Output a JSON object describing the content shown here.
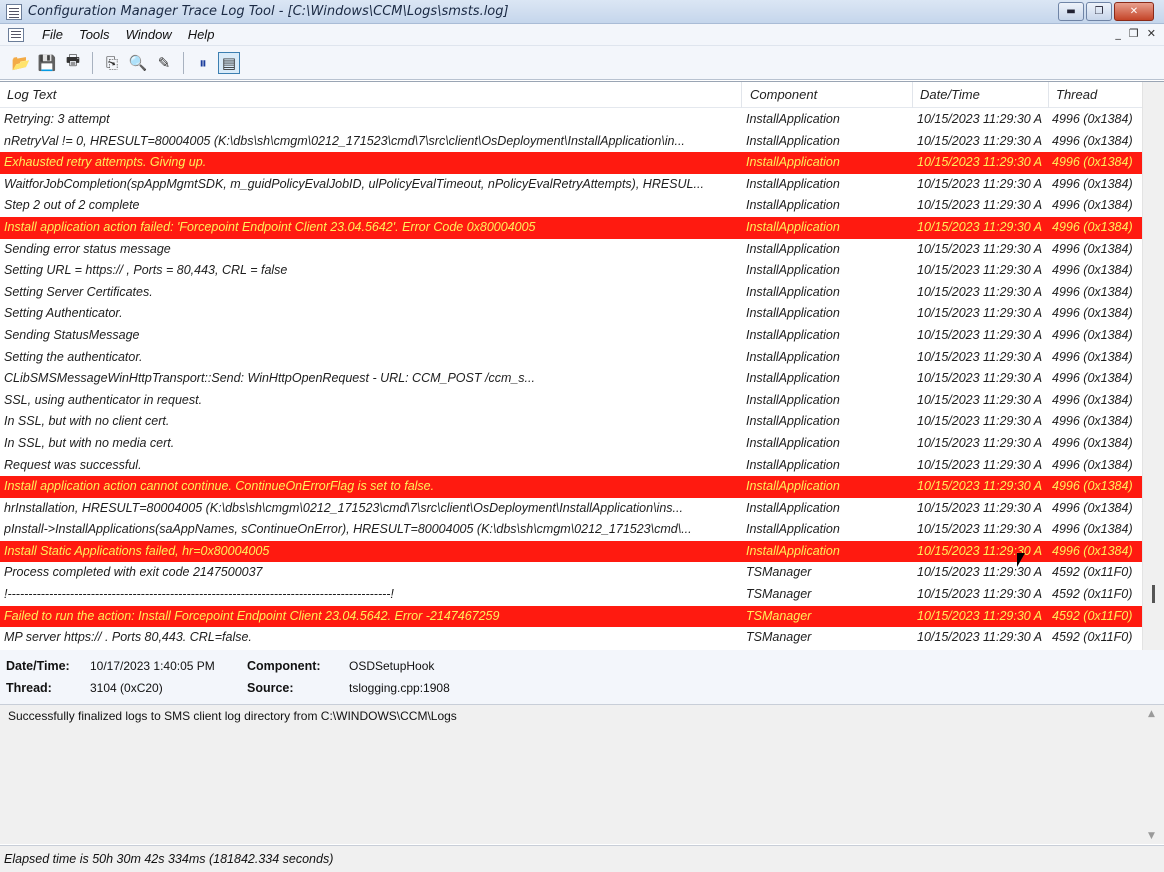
{
  "window": {
    "title": "Configuration Manager Trace Log Tool - [C:\\Windows\\CCM\\Logs\\smsts.log]",
    "min_glyph": "▬",
    "max_glyph": "❐",
    "close_glyph": "✕"
  },
  "menu": {
    "items": [
      "File",
      "Tools",
      "Window",
      "Help"
    ],
    "mdi_min": "_",
    "mdi_restore": "❐",
    "mdi_close": "✕"
  },
  "toolbar": {
    "icons": [
      "open-folder-icon",
      "save-icon",
      "print-icon",
      "copy-icon",
      "find-icon",
      "highlight-icon",
      "pause-icon",
      "details-view-icon"
    ],
    "glyphs": [
      "📂",
      "💾",
      "🖶",
      "⎘",
      "🔍",
      "✎",
      "⏸",
      "▤"
    ]
  },
  "list": {
    "columns": [
      "Log Text",
      "Component",
      "Date/Time",
      "Thread"
    ],
    "rows": [
      {
        "text": "Retrying: 3 attempt",
        "component": "InstallApplication",
        "datetime": "10/15/2023 11:29:30 A",
        "thread": "4996 (0x1384)",
        "error": false
      },
      {
        "text": "nRetryVal != 0, HRESULT=80004005 (K:\\dbs\\sh\\cmgm\\0212_171523\\cmd\\7\\src\\client\\OsDeployment\\InstallApplication\\in...",
        "component": "InstallApplication",
        "datetime": "10/15/2023 11:29:30 A",
        "thread": "4996 (0x1384)",
        "error": false
      },
      {
        "text": "Exhausted retry attempts. Giving up.",
        "component": "InstallApplication",
        "datetime": "10/15/2023 11:29:30 A",
        "thread": "4996 (0x1384)",
        "error": true
      },
      {
        "text": "WaitforJobCompletion(spAppMgmtSDK, m_guidPolicyEvalJobID, ulPolicyEvalTimeout, nPolicyEvalRetryAttempts), HRESUL...",
        "component": "InstallApplication",
        "datetime": "10/15/2023 11:29:30 A",
        "thread": "4996 (0x1384)",
        "error": false
      },
      {
        "text": "Step 2 out of 2 complete",
        "component": "InstallApplication",
        "datetime": "10/15/2023 11:29:30 A",
        "thread": "4996 (0x1384)",
        "error": false
      },
      {
        "text": "Install application action failed: 'Forcepoint Endpoint Client 23.04.5642'. Error Code 0x80004005",
        "component": "InstallApplication",
        "datetime": "10/15/2023 11:29:30 A",
        "thread": "4996 (0x1384)",
        "error": true
      },
      {
        "text": "Sending error status message",
        "component": "InstallApplication",
        "datetime": "10/15/2023 11:29:30 A",
        "thread": "4996 (0x1384)",
        "error": false
      },
      {
        "text": "  Setting URL = https://                                        , Ports = 80,443, CRL = false",
        "component": "InstallApplication",
        "datetime": "10/15/2023 11:29:30 A",
        "thread": "4996 (0x1384)",
        "error": false
      },
      {
        "text": "  Setting Server Certificates.",
        "component": "InstallApplication",
        "datetime": "10/15/2023 11:29:30 A",
        "thread": "4996 (0x1384)",
        "error": false
      },
      {
        "text": "  Setting Authenticator.",
        "component": "InstallApplication",
        "datetime": "10/15/2023 11:29:30 A",
        "thread": "4996 (0x1384)",
        "error": false
      },
      {
        "text": "Sending StatusMessage",
        "component": "InstallApplication",
        "datetime": "10/15/2023 11:29:30 A",
        "thread": "4996 (0x1384)",
        "error": false
      },
      {
        "text": "Setting the authenticator.",
        "component": "InstallApplication",
        "datetime": "10/15/2023 11:29:30 A",
        "thread": "4996 (0x1384)",
        "error": false
      },
      {
        "text": "CLibSMSMessageWinHttpTransport::Send: WinHttpOpenRequest - URL:                                                   CCM_POST /ccm_s...",
        "component": "InstallApplication",
        "datetime": "10/15/2023 11:29:30 A",
        "thread": "4996 (0x1384)",
        "error": false
      },
      {
        "text": "SSL, using authenticator in request.",
        "component": "InstallApplication",
        "datetime": "10/15/2023 11:29:30 A",
        "thread": "4996 (0x1384)",
        "error": false
      },
      {
        "text": "In SSL, but with no client cert.",
        "component": "InstallApplication",
        "datetime": "10/15/2023 11:29:30 A",
        "thread": "4996 (0x1384)",
        "error": false
      },
      {
        "text": "In SSL, but with no media cert.",
        "component": "InstallApplication",
        "datetime": "10/15/2023 11:29:30 A",
        "thread": "4996 (0x1384)",
        "error": false
      },
      {
        "text": "Request was successful.",
        "component": "InstallApplication",
        "datetime": "10/15/2023 11:29:30 A",
        "thread": "4996 (0x1384)",
        "error": false
      },
      {
        "text": "Install application action cannot continue. ContinueOnErrorFlag is set to false.",
        "component": "InstallApplication",
        "datetime": "10/15/2023 11:29:30 A",
        "thread": "4996 (0x1384)",
        "error": true
      },
      {
        "text": "hrInstallation, HRESULT=80004005 (K:\\dbs\\sh\\cmgm\\0212_171523\\cmd\\7\\src\\client\\OsDeployment\\InstallApplication\\ins...",
        "component": "InstallApplication",
        "datetime": "10/15/2023 11:29:30 A",
        "thread": "4996 (0x1384)",
        "error": false
      },
      {
        "text": "pInstall->InstallApplications(saAppNames, sContinueOnError), HRESULT=80004005 (K:\\dbs\\sh\\cmgm\\0212_171523\\cmd\\...",
        "component": "InstallApplication",
        "datetime": "10/15/2023 11:29:30 A",
        "thread": "4996 (0x1384)",
        "error": false
      },
      {
        "text": "Install Static Applications failed, hr=0x80004005",
        "component": "InstallApplication",
        "datetime": "10/15/2023 11:29:30 A",
        "thread": "4996 (0x1384)",
        "error": true
      },
      {
        "text": "Process completed with exit code 2147500037",
        "component": "TSManager",
        "datetime": "10/15/2023 11:29:30 A",
        "thread": "4592 (0x11F0)",
        "error": false
      },
      {
        "text": "!--------------------------------------------------------------------------------------------!",
        "component": "TSManager",
        "datetime": "10/15/2023 11:29:30 A",
        "thread": "4592 (0x11F0)",
        "error": false
      },
      {
        "text": "Failed to run the action: Install Forcepoint Endpoint Client 23.04.5642. Error -2147467259",
        "component": "TSManager",
        "datetime": "10/15/2023 11:29:30 A",
        "thread": "4592 (0x11F0)",
        "error": true
      },
      {
        "text": "MP server https://                                    . Ports 80,443. CRL=false.",
        "component": "TSManager",
        "datetime": "10/15/2023 11:29:30 A",
        "thread": "4592 (0x11F0)",
        "error": false
      }
    ]
  },
  "details": {
    "datetime_label": "Date/Time:",
    "datetime_value": "10/17/2023 1:40:05 PM",
    "component_label": "Component:",
    "component_value": "OSDSetupHook",
    "thread_label": "Thread:",
    "thread_value": "3104 (0xC20)",
    "source_label": "Source:",
    "source_value": "tslogging.cpp:1908",
    "message": "Successfully finalized logs to SMS client log directory from C:\\WINDOWS\\CCM\\Logs"
  },
  "status": {
    "text": "Elapsed time is 50h 30m 42s 334ms (181842.334 seconds)"
  },
  "colors": {
    "error_row_bg": "#ff1a10",
    "error_row_text": "#ffef5a"
  }
}
